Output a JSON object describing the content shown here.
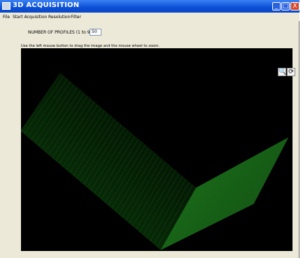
{
  "window": {
    "title": "3D ACQUISITION",
    "controls": {
      "minimize": "_",
      "maximize": "□",
      "close": "X"
    }
  },
  "menu": {
    "items": [
      {
        "label": "File"
      },
      {
        "label": "Start Acquisition"
      },
      {
        "label": "Resolution"
      },
      {
        "label": "Filter"
      }
    ]
  },
  "profiles": {
    "label": "NUMBER OF PROFILES (1 to 999)",
    "value": "50"
  },
  "instruction": "Use the left mouse button to drag the image and the mouse wheel to zoom.",
  "toolbar": {
    "zoom_icon": "zoom-icon",
    "reset_icon": "rotate-icon",
    "zoom_glyph": "🔍",
    "reset_glyph": "⟳"
  },
  "colors": {
    "viewer_background": "#000000",
    "mesh_color": "#1faa1f",
    "titlebar": "#0a4fd6"
  }
}
